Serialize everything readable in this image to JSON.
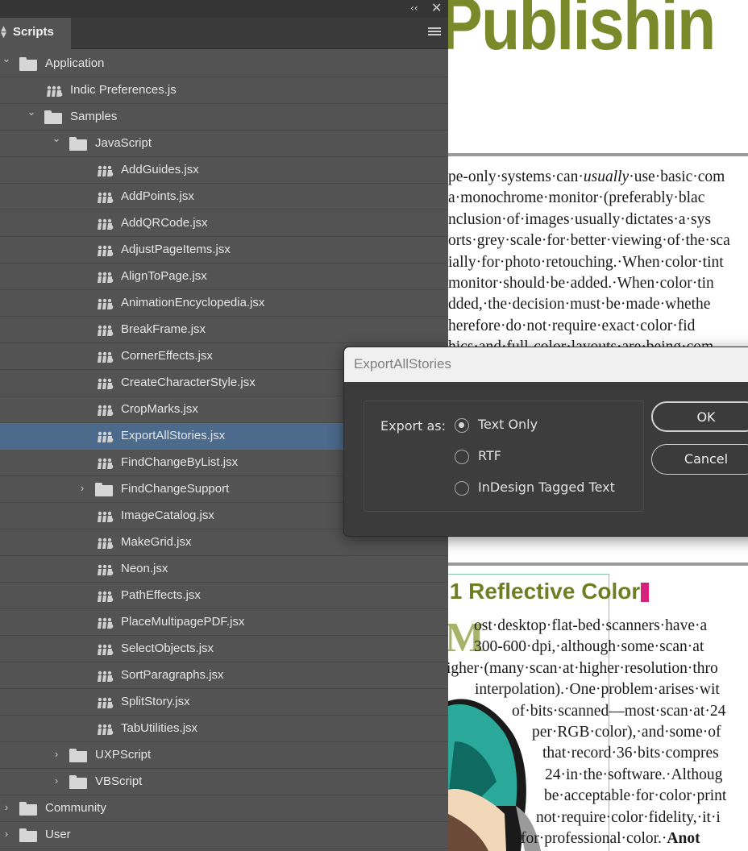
{
  "panel": {
    "tab_label": "Scripts",
    "collapse_glyph": "‹‹",
    "close_glyph": "✕",
    "tree": [
      {
        "label": "Application",
        "type": "folder",
        "level": 0,
        "expanded": true
      },
      {
        "label": "Indic Preferences.js",
        "type": "script",
        "level": 1
      },
      {
        "label": "Samples",
        "type": "folder",
        "level": 1,
        "expanded": true
      },
      {
        "label": "JavaScript",
        "type": "folder",
        "level": 2,
        "expanded": true
      },
      {
        "label": "AddGuides.jsx",
        "type": "script",
        "level": 3
      },
      {
        "label": "AddPoints.jsx",
        "type": "script",
        "level": 3
      },
      {
        "label": "AddQRCode.jsx",
        "type": "script",
        "level": 3
      },
      {
        "label": "AdjustPageItems.jsx",
        "type": "script",
        "level": 3
      },
      {
        "label": "AlignToPage.jsx",
        "type": "script",
        "level": 3
      },
      {
        "label": "AnimationEncyclopedia.jsx",
        "type": "script",
        "level": 3
      },
      {
        "label": "BreakFrame.jsx",
        "type": "script",
        "level": 3
      },
      {
        "label": "CornerEffects.jsx",
        "type": "script",
        "level": 3
      },
      {
        "label": "CreateCharacterStyle.jsx",
        "type": "script",
        "level": 3
      },
      {
        "label": "CropMarks.jsx",
        "type": "script",
        "level": 3
      },
      {
        "label": "ExportAllStories.jsx",
        "type": "script",
        "level": 3,
        "selected": true
      },
      {
        "label": "FindChangeByList.jsx",
        "type": "script",
        "level": 3
      },
      {
        "label": "FindChangeSupport",
        "type": "folder",
        "level": 3,
        "expanded": false
      },
      {
        "label": "ImageCatalog.jsx",
        "type": "script",
        "level": 3
      },
      {
        "label": "MakeGrid.jsx",
        "type": "script",
        "level": 3
      },
      {
        "label": "Neon.jsx",
        "type": "script",
        "level": 3
      },
      {
        "label": "PathEffects.jsx",
        "type": "script",
        "level": 3
      },
      {
        "label": "PlaceMultipagePDF.jsx",
        "type": "script",
        "level": 3
      },
      {
        "label": "SelectObjects.jsx",
        "type": "script",
        "level": 3
      },
      {
        "label": "SortParagraphs.jsx",
        "type": "script",
        "level": 3
      },
      {
        "label": "SplitStory.jsx",
        "type": "script",
        "level": 3
      },
      {
        "label": "TabUtilities.jsx",
        "type": "script",
        "level": 3
      },
      {
        "label": "UXPScript",
        "type": "folder",
        "level": 2,
        "expanded": false
      },
      {
        "label": "VBScript",
        "type": "folder",
        "level": 2,
        "expanded": false
      },
      {
        "label": "Community",
        "type": "folder",
        "level": 0,
        "expanded": false
      },
      {
        "label": "User",
        "type": "folder",
        "level": 0,
        "expanded": false
      }
    ]
  },
  "dialog": {
    "title": "ExportAllStories",
    "export_label": "Export as:",
    "options": [
      {
        "label": "Text Only",
        "checked": true
      },
      {
        "label": "RTF",
        "checked": false
      },
      {
        "label": "InDesign Tagged Text",
        "checked": false
      }
    ],
    "ok_label": "OK",
    "cancel_label": "Cancel"
  },
  "document": {
    "title_fragment": "Publishin",
    "paragraph_lines": [
      "pe-only·systems·can·usually·use·basic·com",
      "a·monochrome·monitor·(preferably·blac",
      "nclusion·of·images·usually·dictates·a·sys",
      "orts·grey·scale·for·better·viewing·of·the·sca",
      "ially·for·photo·retouching.·When·color·tint",
      "monitor·should·be·added.·When·color·tin",
      "dded,·the·decision·must·be·made·whethe",
      "herefore·do·not·require·exact·color·fid",
      "hics·and·full-color·layouts·are·being·com"
    ],
    "section_heading": ".1 Reflective Color",
    "dropcap": "M",
    "section_lines": [
      "ost·desktop·flat-bed·scanners·have·a",
      "300-600·dpi,·although·some·scan·at",
      "igher·(many·scan·at·higher·resolution·thro",
      "interpolation).·One·problem·arises·wit",
      "of·bits·scanned—most·scan·at·24",
      "per·RGB·color),·and·some·of",
      "that·record·36·bits·compres",
      "24·in·the·software.·Althoug",
      "be·acceptable·for·color·print",
      "not·require·color·fidelity,·it·i",
      "for·professional·color.·Anot"
    ]
  },
  "colors": {
    "panel_bg": "#535353",
    "selected_row": "#4b6a8c",
    "dialog_bg": "#3b3b3b",
    "title_green": "#7a8a2a"
  }
}
